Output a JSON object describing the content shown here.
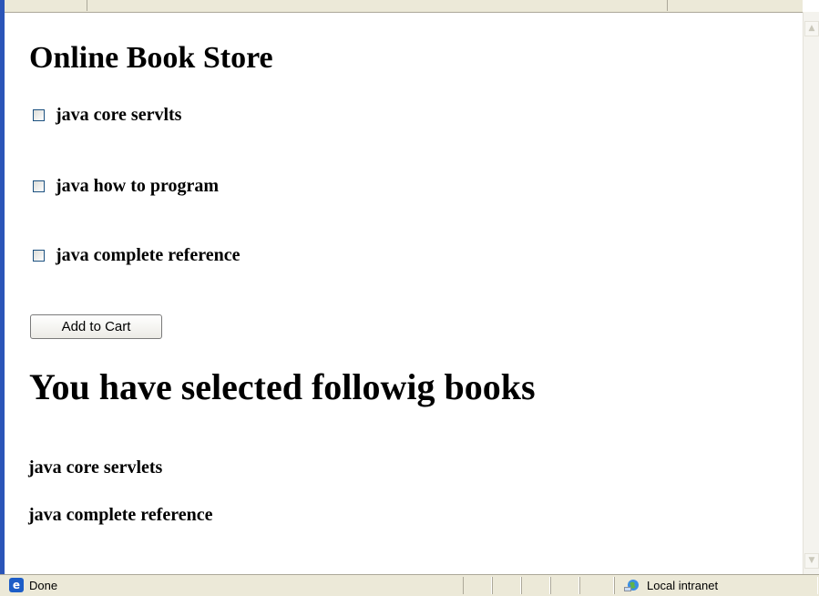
{
  "page": {
    "heading": "Online Book Store",
    "books": [
      {
        "label": "java core servlts",
        "checked": false
      },
      {
        "label": "java how to program",
        "checked": false
      },
      {
        "label": "java complete reference",
        "checked": false
      }
    ],
    "add_button_label": "Add to Cart",
    "selected_heading": "You have selected followig books",
    "selected_books": [
      "java core servlets",
      "java complete reference"
    ]
  },
  "statusbar": {
    "status_text": "Done",
    "status_icon": "ie-page-icon",
    "zone_icon": "local-intranet-icon",
    "zone_text": "Local intranet"
  },
  "scrollbar": {
    "up_icon": "scroll-up-arrow-icon",
    "down_icon": "scroll-down-arrow-icon"
  },
  "colors": {
    "frame_blue": "#2b55b8",
    "statusbar_bg": "#ece9d8",
    "checkbox_border": "#1c5180"
  }
}
